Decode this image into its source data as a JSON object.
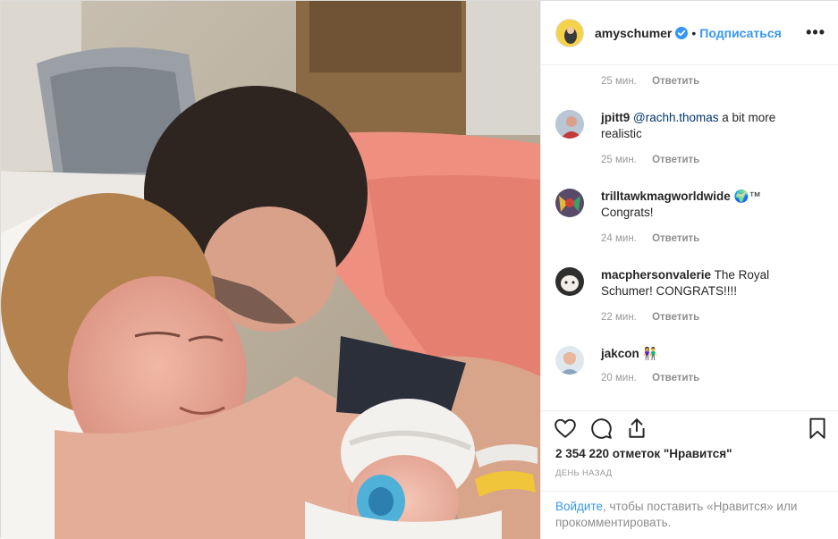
{
  "header": {
    "username": "amyschumer",
    "follow_label": "Подписаться",
    "separator": "•",
    "more_label": "•••"
  },
  "top_meta": {
    "time": "25 мин.",
    "reply": "Ответить"
  },
  "comments": [
    {
      "username": "jpitt9",
      "mention": "@rachh.thomas",
      "text": " a bit more realistic",
      "time": "25 мин.",
      "reply": "Ответить"
    },
    {
      "username": "trilltawkmagworldwide",
      "text": " 🌍™ Congrats!",
      "time": "24 мин.",
      "reply": "Ответить"
    },
    {
      "username": "macphersonvalerie",
      "text": " The Royal Schumer! CONGRATS!!!!",
      "time": "22 мин.",
      "reply": "Ответить"
    },
    {
      "username": "jakcon",
      "text": " 👫",
      "time": "20 мин.",
      "reply": "Ответить"
    }
  ],
  "actions": {
    "likes": "2 354 220 отметок \"Нравится\"",
    "date": "День назад",
    "icons": [
      "heart-icon",
      "comment-icon",
      "share-icon",
      "bookmark-icon"
    ]
  },
  "login": {
    "link": "Войдите",
    "text": ", чтобы поставить «Нравится» или прокомментировать."
  },
  "colors": {
    "link_blue": "#3897f0",
    "verified_blue": "#3897f0",
    "meta_gray": "#999999"
  }
}
